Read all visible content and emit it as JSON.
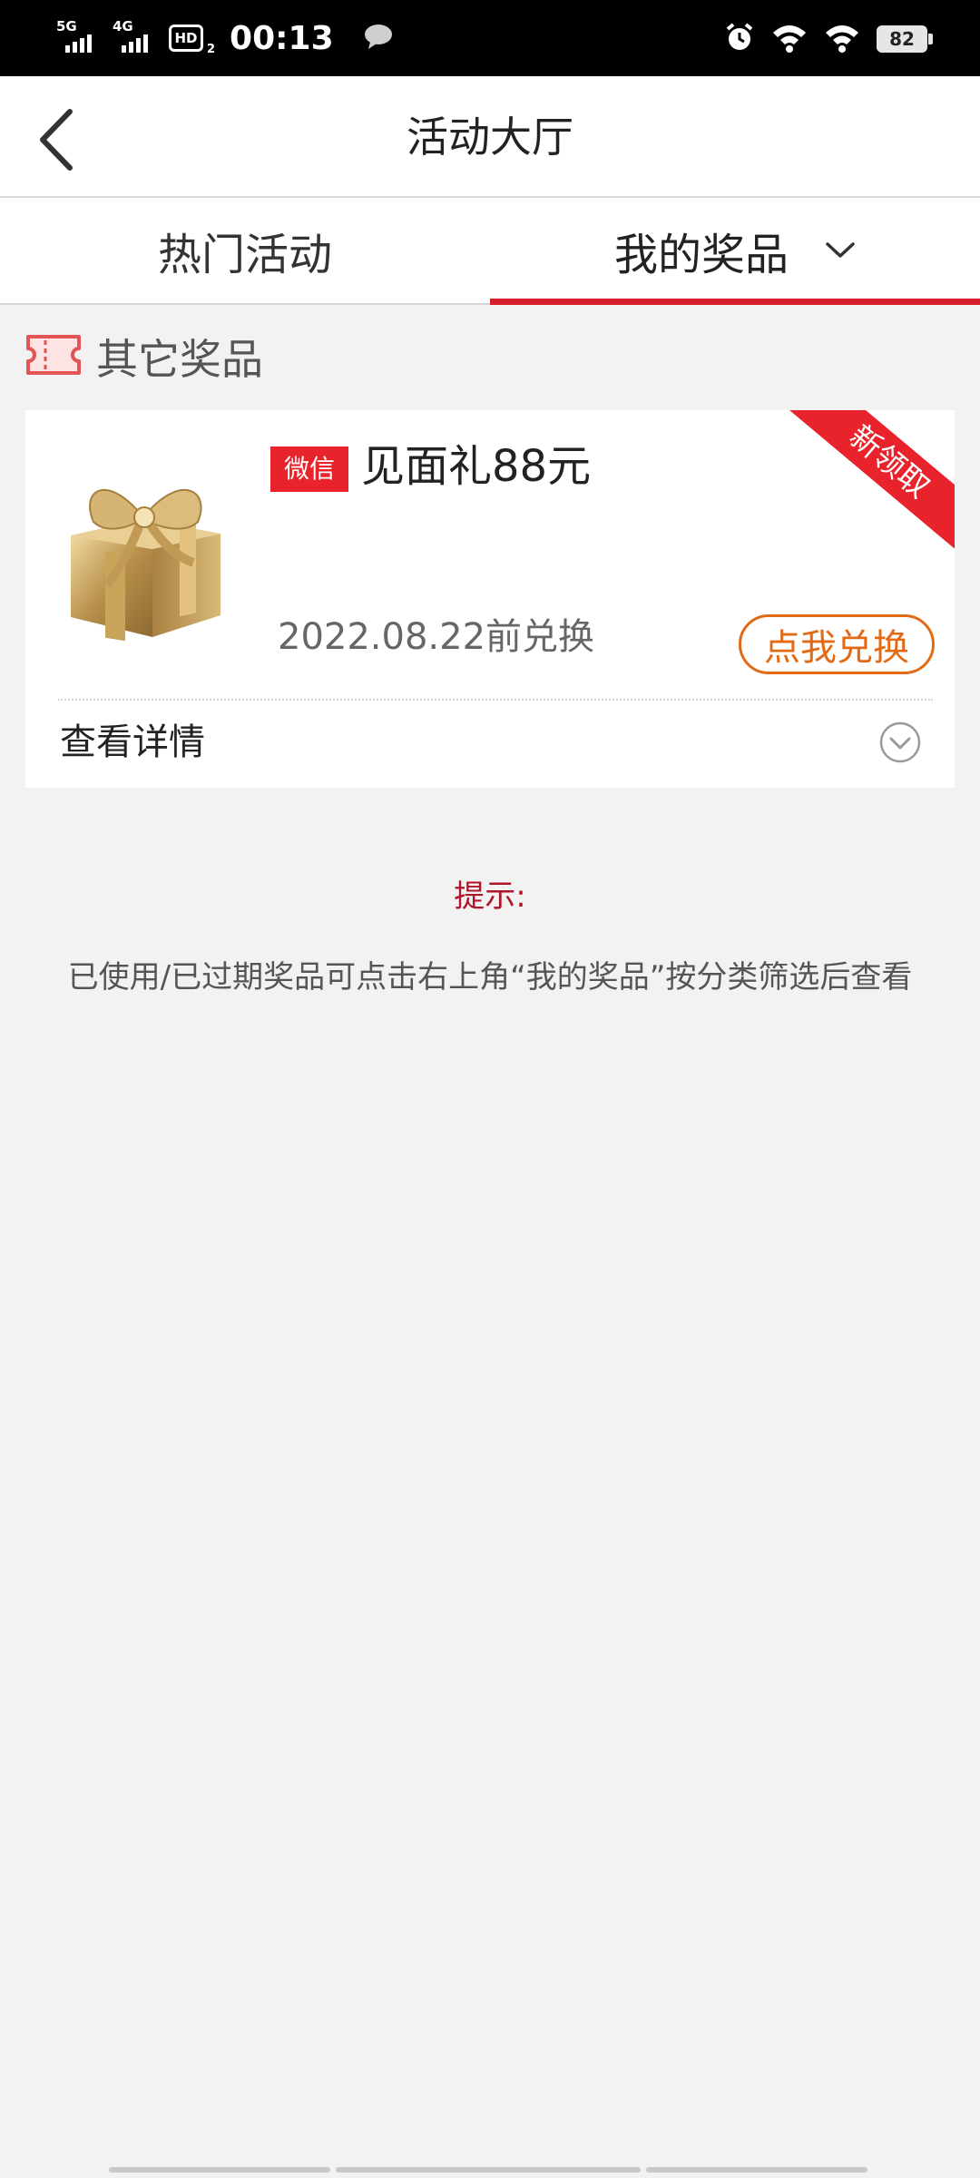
{
  "status_bar": {
    "network1": "5G",
    "network2": "4G",
    "hd": "HD",
    "hd_sub": "2",
    "time": "00:13",
    "battery": "82"
  },
  "header": {
    "title": "活动大厅"
  },
  "tabs": [
    {
      "label": "热门活动",
      "active": false
    },
    {
      "label": "我的奖品",
      "active": true
    }
  ],
  "section": {
    "title": "其它奖品"
  },
  "prize": {
    "source": "微信",
    "title": "见面礼88元",
    "expire": "2022.08.22前兑换",
    "redeem_label": "点我兑换",
    "ribbon": "新领取",
    "detail_label": "查看详情"
  },
  "tip": {
    "title": "提示:",
    "body": "已使用/已过期奖品可点击右上角“我的奖品”按分类筛选后查看"
  },
  "colors": {
    "accent": "#d81e2a",
    "badge": "#e8232b",
    "redeem": "#e36a14",
    "tip_title": "#b0162a"
  }
}
